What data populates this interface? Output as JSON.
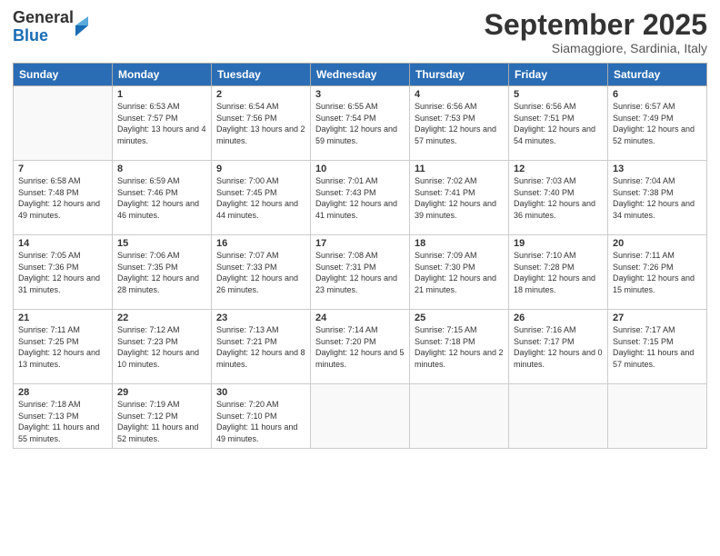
{
  "logo": {
    "general": "General",
    "blue": "Blue"
  },
  "title": "September 2025",
  "location": "Siamaggiore, Sardinia, Italy",
  "days_header": [
    "Sunday",
    "Monday",
    "Tuesday",
    "Wednesday",
    "Thursday",
    "Friday",
    "Saturday"
  ],
  "weeks": [
    [
      {
        "day": "",
        "sunrise": "",
        "sunset": "",
        "daylight": ""
      },
      {
        "day": "1",
        "sunrise": "Sunrise: 6:53 AM",
        "sunset": "Sunset: 7:57 PM",
        "daylight": "Daylight: 13 hours and 4 minutes."
      },
      {
        "day": "2",
        "sunrise": "Sunrise: 6:54 AM",
        "sunset": "Sunset: 7:56 PM",
        "daylight": "Daylight: 13 hours and 2 minutes."
      },
      {
        "day": "3",
        "sunrise": "Sunrise: 6:55 AM",
        "sunset": "Sunset: 7:54 PM",
        "daylight": "Daylight: 12 hours and 59 minutes."
      },
      {
        "day": "4",
        "sunrise": "Sunrise: 6:56 AM",
        "sunset": "Sunset: 7:53 PM",
        "daylight": "Daylight: 12 hours and 57 minutes."
      },
      {
        "day": "5",
        "sunrise": "Sunrise: 6:56 AM",
        "sunset": "Sunset: 7:51 PM",
        "daylight": "Daylight: 12 hours and 54 minutes."
      },
      {
        "day": "6",
        "sunrise": "Sunrise: 6:57 AM",
        "sunset": "Sunset: 7:49 PM",
        "daylight": "Daylight: 12 hours and 52 minutes."
      }
    ],
    [
      {
        "day": "7",
        "sunrise": "Sunrise: 6:58 AM",
        "sunset": "Sunset: 7:48 PM",
        "daylight": "Daylight: 12 hours and 49 minutes."
      },
      {
        "day": "8",
        "sunrise": "Sunrise: 6:59 AM",
        "sunset": "Sunset: 7:46 PM",
        "daylight": "Daylight: 12 hours and 46 minutes."
      },
      {
        "day": "9",
        "sunrise": "Sunrise: 7:00 AM",
        "sunset": "Sunset: 7:45 PM",
        "daylight": "Daylight: 12 hours and 44 minutes."
      },
      {
        "day": "10",
        "sunrise": "Sunrise: 7:01 AM",
        "sunset": "Sunset: 7:43 PM",
        "daylight": "Daylight: 12 hours and 41 minutes."
      },
      {
        "day": "11",
        "sunrise": "Sunrise: 7:02 AM",
        "sunset": "Sunset: 7:41 PM",
        "daylight": "Daylight: 12 hours and 39 minutes."
      },
      {
        "day": "12",
        "sunrise": "Sunrise: 7:03 AM",
        "sunset": "Sunset: 7:40 PM",
        "daylight": "Daylight: 12 hours and 36 minutes."
      },
      {
        "day": "13",
        "sunrise": "Sunrise: 7:04 AM",
        "sunset": "Sunset: 7:38 PM",
        "daylight": "Daylight: 12 hours and 34 minutes."
      }
    ],
    [
      {
        "day": "14",
        "sunrise": "Sunrise: 7:05 AM",
        "sunset": "Sunset: 7:36 PM",
        "daylight": "Daylight: 12 hours and 31 minutes."
      },
      {
        "day": "15",
        "sunrise": "Sunrise: 7:06 AM",
        "sunset": "Sunset: 7:35 PM",
        "daylight": "Daylight: 12 hours and 28 minutes."
      },
      {
        "day": "16",
        "sunrise": "Sunrise: 7:07 AM",
        "sunset": "Sunset: 7:33 PM",
        "daylight": "Daylight: 12 hours and 26 minutes."
      },
      {
        "day": "17",
        "sunrise": "Sunrise: 7:08 AM",
        "sunset": "Sunset: 7:31 PM",
        "daylight": "Daylight: 12 hours and 23 minutes."
      },
      {
        "day": "18",
        "sunrise": "Sunrise: 7:09 AM",
        "sunset": "Sunset: 7:30 PM",
        "daylight": "Daylight: 12 hours and 21 minutes."
      },
      {
        "day": "19",
        "sunrise": "Sunrise: 7:10 AM",
        "sunset": "Sunset: 7:28 PM",
        "daylight": "Daylight: 12 hours and 18 minutes."
      },
      {
        "day": "20",
        "sunrise": "Sunrise: 7:11 AM",
        "sunset": "Sunset: 7:26 PM",
        "daylight": "Daylight: 12 hours and 15 minutes."
      }
    ],
    [
      {
        "day": "21",
        "sunrise": "Sunrise: 7:11 AM",
        "sunset": "Sunset: 7:25 PM",
        "daylight": "Daylight: 12 hours and 13 minutes."
      },
      {
        "day": "22",
        "sunrise": "Sunrise: 7:12 AM",
        "sunset": "Sunset: 7:23 PM",
        "daylight": "Daylight: 12 hours and 10 minutes."
      },
      {
        "day": "23",
        "sunrise": "Sunrise: 7:13 AM",
        "sunset": "Sunset: 7:21 PM",
        "daylight": "Daylight: 12 hours and 8 minutes."
      },
      {
        "day": "24",
        "sunrise": "Sunrise: 7:14 AM",
        "sunset": "Sunset: 7:20 PM",
        "daylight": "Daylight: 12 hours and 5 minutes."
      },
      {
        "day": "25",
        "sunrise": "Sunrise: 7:15 AM",
        "sunset": "Sunset: 7:18 PM",
        "daylight": "Daylight: 12 hours and 2 minutes."
      },
      {
        "day": "26",
        "sunrise": "Sunrise: 7:16 AM",
        "sunset": "Sunset: 7:17 PM",
        "daylight": "Daylight: 12 hours and 0 minutes."
      },
      {
        "day": "27",
        "sunrise": "Sunrise: 7:17 AM",
        "sunset": "Sunset: 7:15 PM",
        "daylight": "Daylight: 11 hours and 57 minutes."
      }
    ],
    [
      {
        "day": "28",
        "sunrise": "Sunrise: 7:18 AM",
        "sunset": "Sunset: 7:13 PM",
        "daylight": "Daylight: 11 hours and 55 minutes."
      },
      {
        "day": "29",
        "sunrise": "Sunrise: 7:19 AM",
        "sunset": "Sunset: 7:12 PM",
        "daylight": "Daylight: 11 hours and 52 minutes."
      },
      {
        "day": "30",
        "sunrise": "Sunrise: 7:20 AM",
        "sunset": "Sunset: 7:10 PM",
        "daylight": "Daylight: 11 hours and 49 minutes."
      },
      {
        "day": "",
        "sunrise": "",
        "sunset": "",
        "daylight": ""
      },
      {
        "day": "",
        "sunrise": "",
        "sunset": "",
        "daylight": ""
      },
      {
        "day": "",
        "sunrise": "",
        "sunset": "",
        "daylight": ""
      },
      {
        "day": "",
        "sunrise": "",
        "sunset": "",
        "daylight": ""
      }
    ]
  ]
}
